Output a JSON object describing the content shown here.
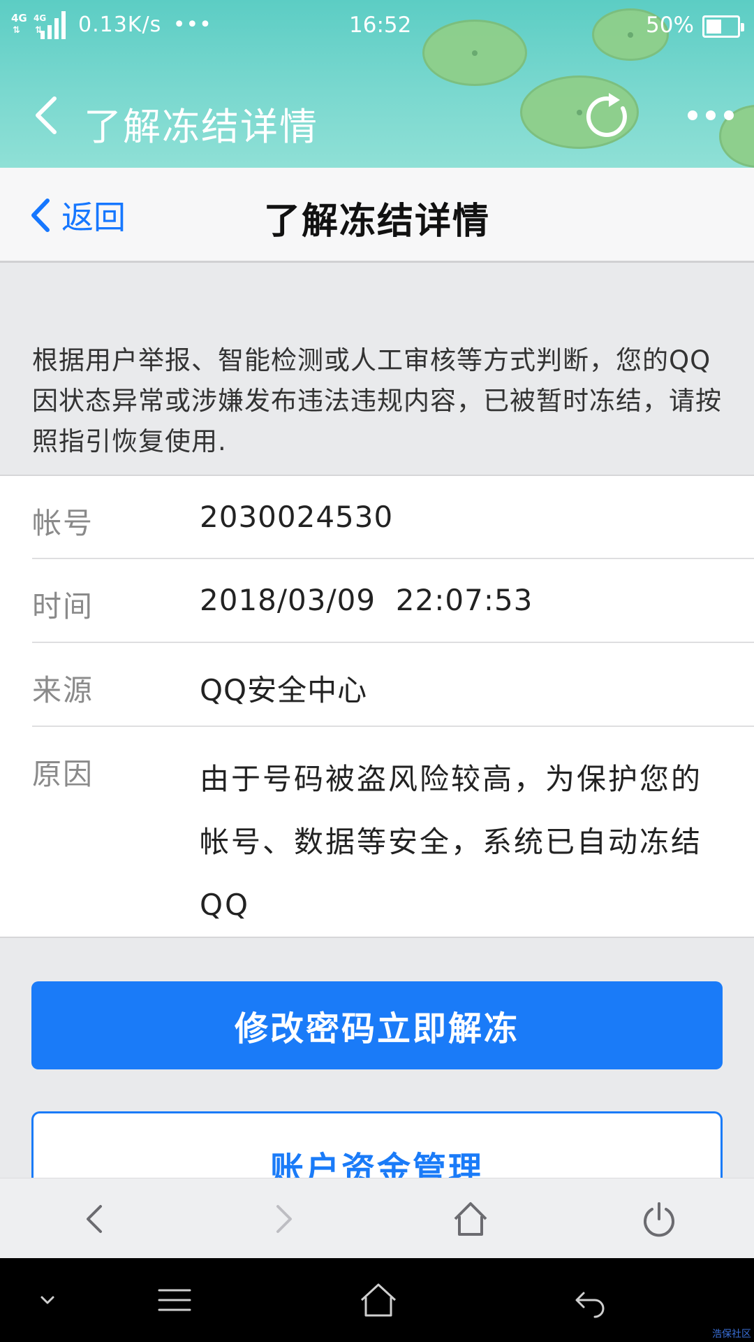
{
  "status_bar": {
    "network_type_1": "4G",
    "network_type_2": "4G",
    "speed": "0.13K/s",
    "more": "•••",
    "time": "16:52",
    "battery_text": "50%",
    "battery_level": 0.5
  },
  "header": {
    "title": "了解冻结详情",
    "icons": [
      "back-icon",
      "refresh-icon",
      "more-icon"
    ]
  },
  "page_nav": {
    "back_label": "返回",
    "title": "了解冻结详情"
  },
  "notice": {
    "text": "根据用户举报、智能检测或人工审核等方式判断，您的QQ因状态异常或涉嫌发布违法违规内容，已被暂时冻结，请按照指引恢复使用."
  },
  "info": {
    "account": {
      "label": "帐号",
      "value": "2030024530"
    },
    "time": {
      "label": "时间",
      "value": "2018/03/09  22:07:53"
    },
    "source": {
      "label": "来源",
      "value": "QQ安全中心"
    },
    "reason": {
      "label": "原因",
      "value": "由于号码被盗风险较高，为保护您的帐号、数据等安全，系统已自动冻结QQ"
    }
  },
  "actions": {
    "primary_label": "修改密码立即解冻",
    "secondary_label": "账户资金管理"
  },
  "browser_toolbar": {
    "icons": [
      "back-arrow-icon",
      "forward-arrow-icon",
      "home-icon",
      "power-icon"
    ]
  },
  "system_nav": {
    "icons": [
      "collapse-icon",
      "menu-icon",
      "home-icon",
      "return-icon"
    ]
  },
  "watermark": "浩保社区",
  "colors": {
    "accent": "#1a7bf8",
    "header": "#6fd5cb",
    "background": "#e9eaec"
  }
}
